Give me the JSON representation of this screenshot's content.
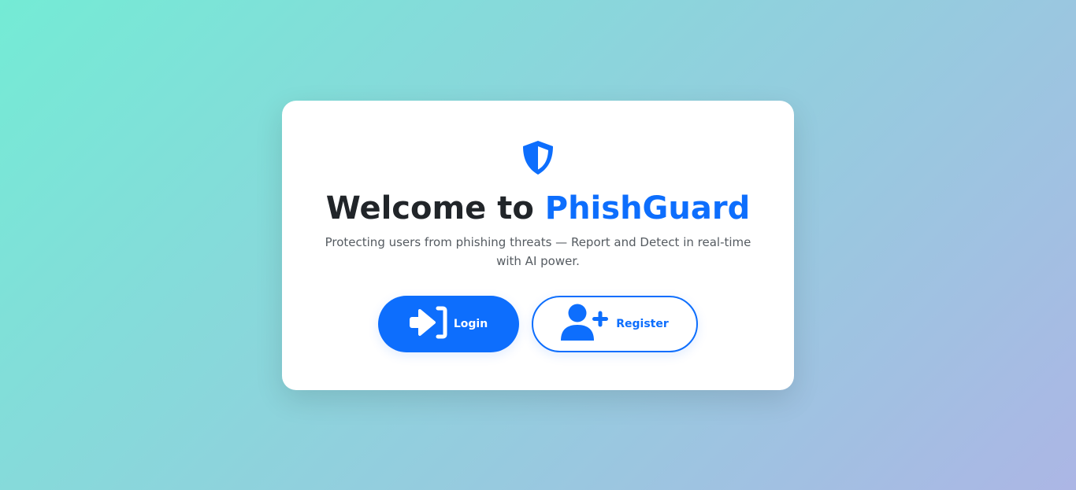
{
  "welcome": {
    "prefix": "Welcome to ",
    "brand": "PhishGuard",
    "subtitle": "Protecting users from phishing threats — Report and Detect in real-time with AI power."
  },
  "buttons": {
    "login_label": "Login",
    "register_label": "Register"
  },
  "icons": {
    "logo": "shield-half-icon",
    "login": "sign-in-icon",
    "register": "user-plus-icon"
  },
  "colors": {
    "accent": "#0d6efd",
    "heading": "#212529",
    "muted": "#555b61",
    "bg_start": "#74ebd5",
    "bg_end": "#acb6e5"
  }
}
